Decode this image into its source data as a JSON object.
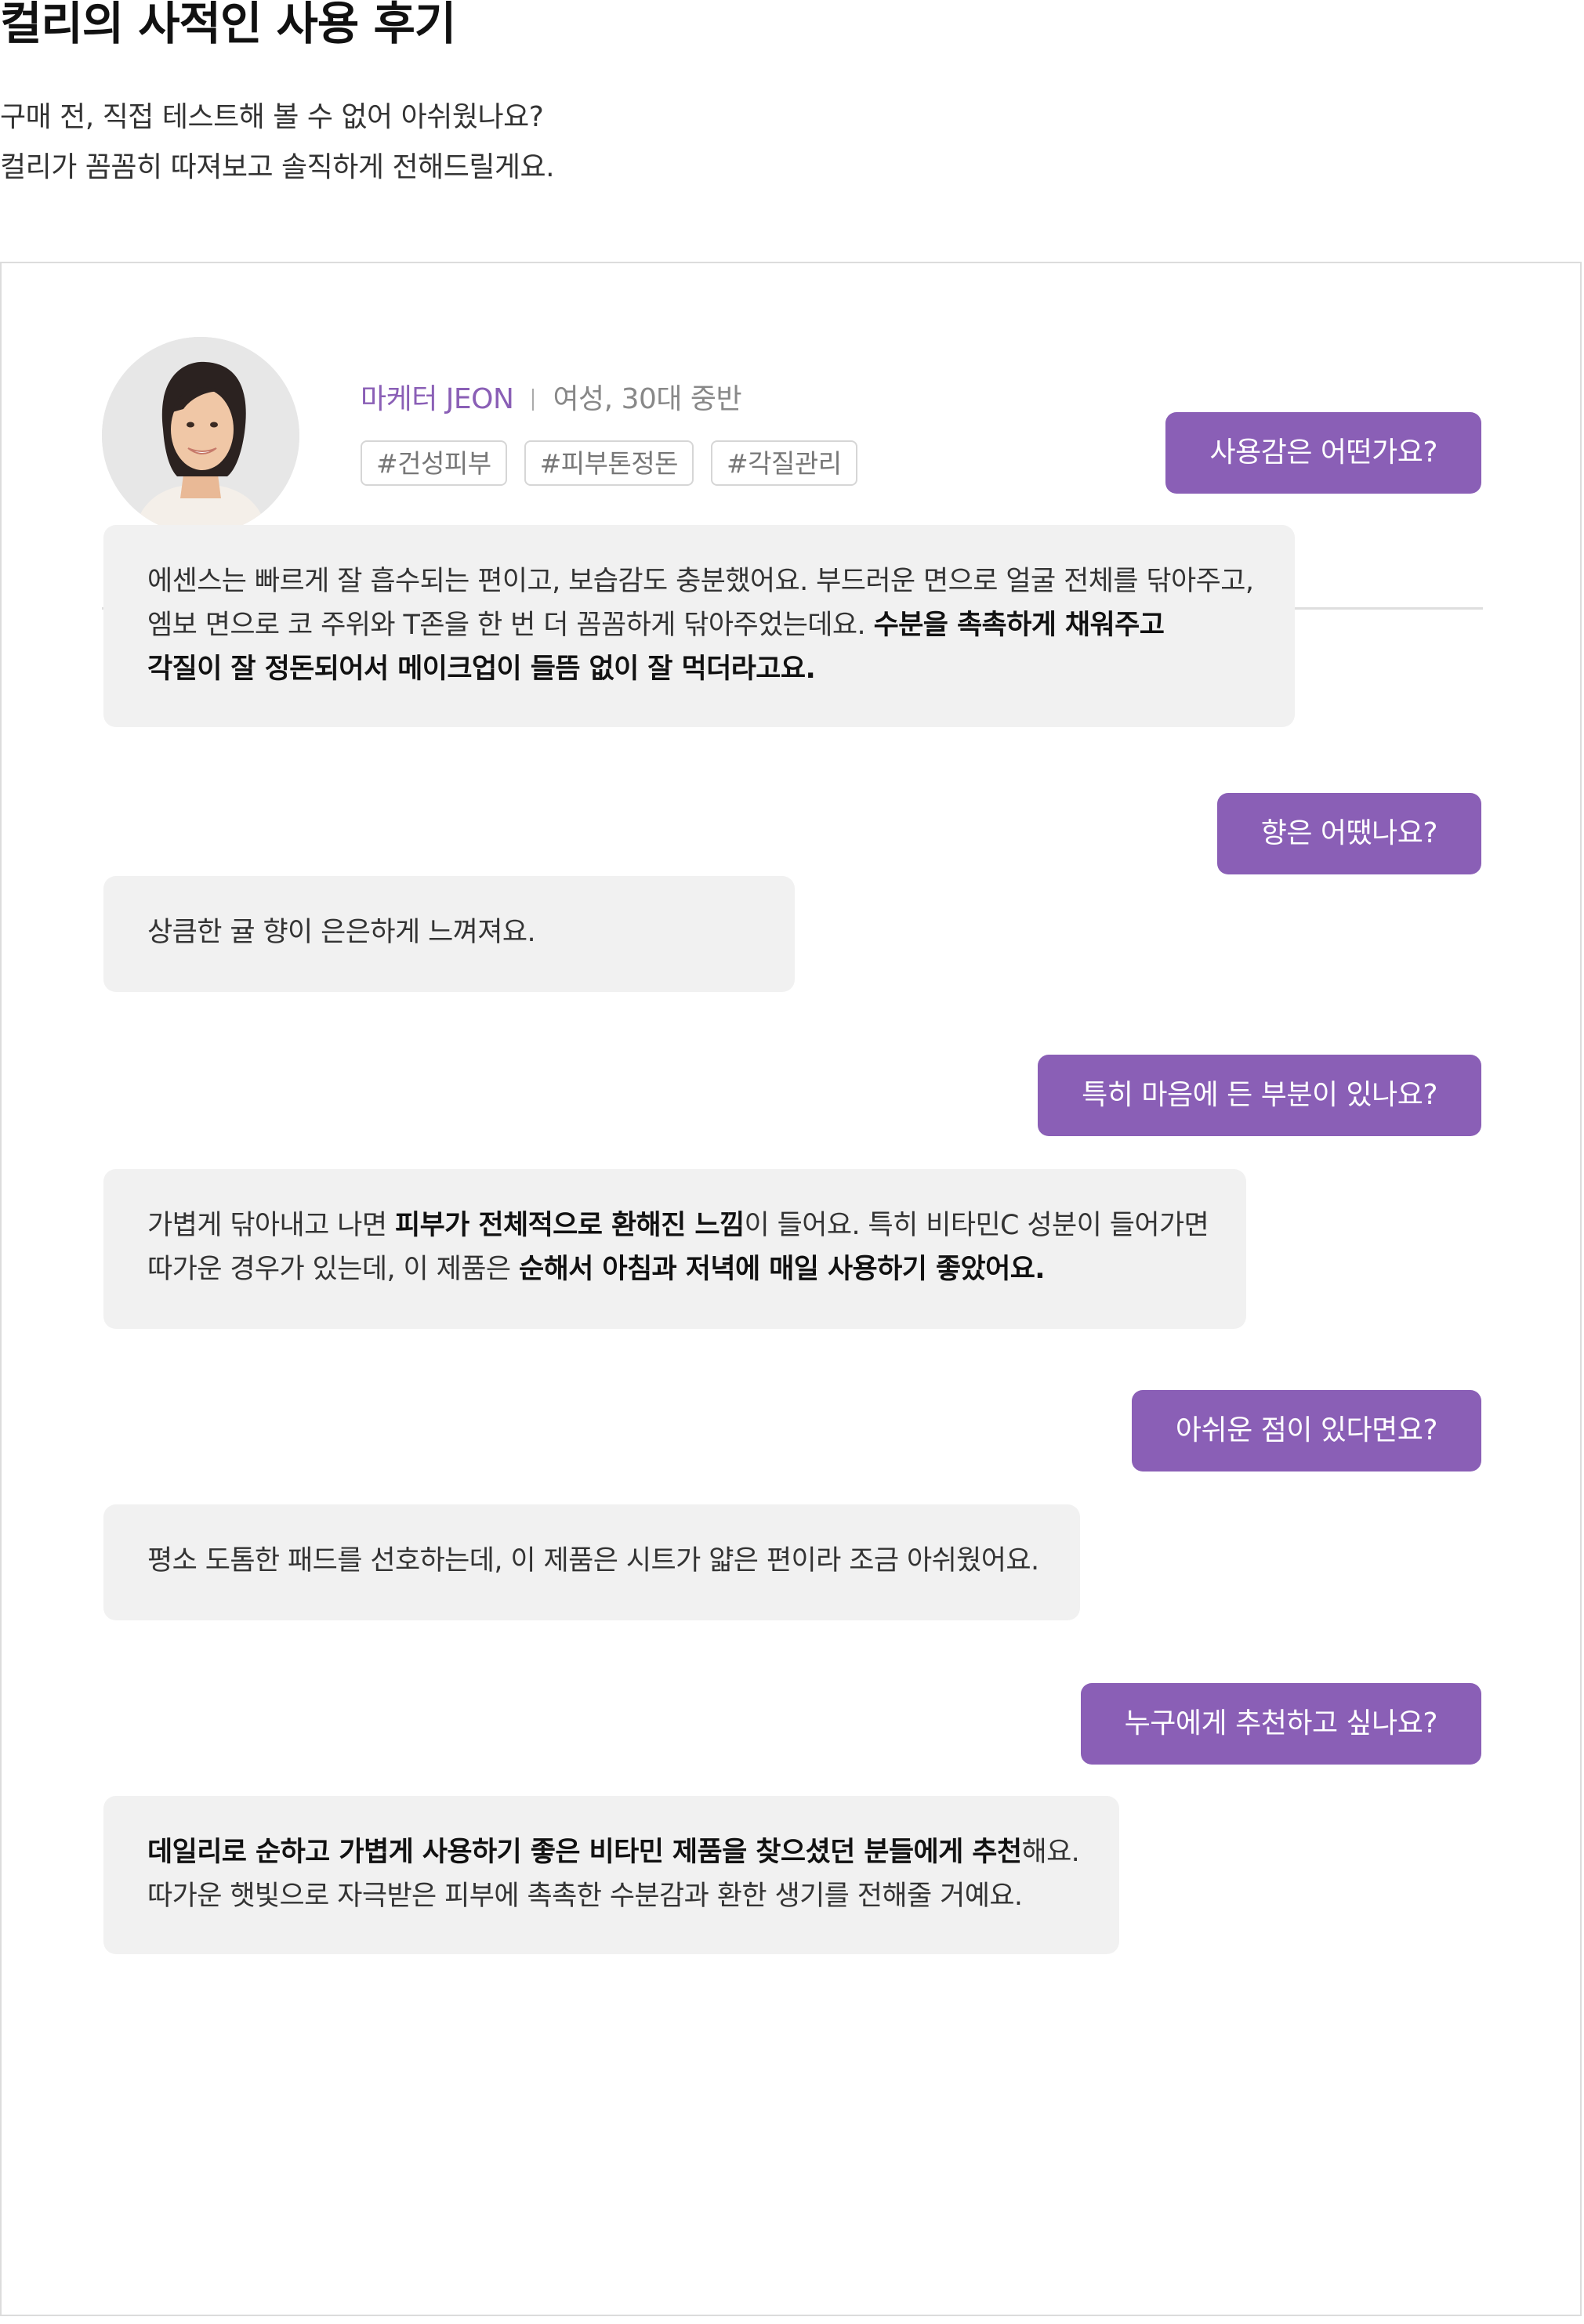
{
  "header": {
    "title": "컬리의 사적인 사용 후기",
    "subtitle_lines": [
      "구매 전, 직접 테스트해 볼 수 없어 아쉬웠나요?",
      "컬리가 꼼꼼히 따져보고 솔직하게 전해드릴게요."
    ]
  },
  "reviewer": {
    "name": "마케터 JEON",
    "meta": "여성, 30대 중반",
    "tags": [
      "#건성피부",
      "#피부톤정돈",
      "#각질관리"
    ]
  },
  "qa": [
    {
      "question": "사용감은 어떤가요?",
      "answer_lines": [
        [
          {
            "t": "에센스는 빠르게 잘 흡수되는 편이고, 보습감도 충분했어요. 부드러운 면으로 얼굴 전체를 닦아주고,"
          }
        ],
        [
          {
            "t": "엠보 면으로 코 주위와 T존을 한 번 더 꼼꼼하게 닦아주었는데요. "
          },
          {
            "t": "수분을 촉촉하게 채워주고",
            "b": true
          }
        ],
        [
          {
            "t": "각질이 잘 정돈되어서 메이크업이 들뜸 없이 잘 먹더라고요.",
            "b": true
          }
        ]
      ]
    },
    {
      "question": "향은 어땠나요?",
      "answer_lines": [
        [
          {
            "t": "상큼한 귤 향이 은은하게 느껴져요."
          }
        ]
      ]
    },
    {
      "question": "특히 마음에 든 부분이 있나요?",
      "answer_lines": [
        [
          {
            "t": "가볍게 닦아내고 나면 "
          },
          {
            "t": "피부가 전체적으로 환해진 느낌",
            "b": true
          },
          {
            "t": "이 들어요. 특히 비타민C 성분이 들어가면"
          }
        ],
        [
          {
            "t": "따가운 경우가 있는데, 이 제품은 "
          },
          {
            "t": "순해서 아침과 저녁에 매일 사용하기 좋았어요.",
            "b": true
          }
        ]
      ]
    },
    {
      "question": "아쉬운 점이 있다면요?",
      "answer_lines": [
        [
          {
            "t": "평소 도톰한 패드를 선호하는데, 이 제품은 시트가 얇은 편이라 조금 아쉬웠어요."
          }
        ]
      ]
    },
    {
      "question": "누구에게 추천하고 싶나요?",
      "answer_lines": [
        [
          {
            "t": "데일리로 순하고 가볍게 사용하기 좋은 비타민 제품을 찾으셨던 분들에게 추천",
            "b": true
          },
          {
            "t": "해요."
          }
        ],
        [
          {
            "t": "따가운 햇빛으로 자극받은 피부에 촉촉한 수분감과 환한 생기를 전해줄 거예요."
          }
        ]
      ]
    }
  ],
  "colors": {
    "accent": "#8a5fb6",
    "answer_bg": "#f1f1f1",
    "border": "#dcdcdc"
  }
}
